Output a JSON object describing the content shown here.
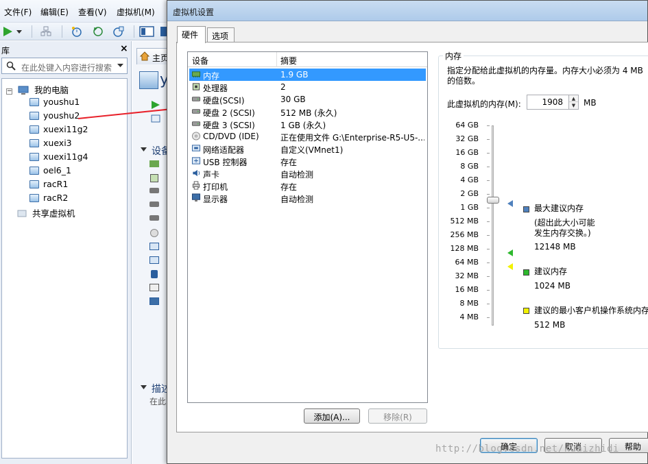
{
  "menu": {
    "file": "文件(F)",
    "edit": "编辑(E)",
    "view": "查看(V)",
    "vm": "虚拟机(M)"
  },
  "library": {
    "title": "库",
    "search_placeholder": "在此处键入内容进行搜索",
    "root": "我的电脑",
    "vms": [
      "youshu1",
      "youshu2",
      "xuexi11g2",
      "xuexi3",
      "xuexi11g4",
      "oel6_1",
      "racR1",
      "racR2"
    ],
    "shared": "共享虚拟机"
  },
  "middle": {
    "home_tab": "主页",
    "vm_title_fragment": "y",
    "devices_fragment": "设备",
    "desc_fragment": "描述",
    "desc_hint_fragment": "在此"
  },
  "dialog": {
    "title": "虚拟机设置",
    "tabs": [
      "硬件",
      "选项"
    ],
    "list_headers": {
      "device": "设备",
      "summary": "摘要"
    },
    "devices": [
      {
        "name": "内存",
        "summary": "1.9 GB",
        "icon": "memory-icon",
        "selected": true
      },
      {
        "name": "处理器",
        "summary": "2",
        "icon": "processor-icon"
      },
      {
        "name": "硬盘(SCSI)",
        "summary": "30 GB",
        "icon": "hard-disk-icon"
      },
      {
        "name": "硬盘 2 (SCSI)",
        "summary": "512 MB (永久)",
        "icon": "hard-disk-icon"
      },
      {
        "name": "硬盘 3 (SCSI)",
        "summary": "1 GB (永久)",
        "icon": "hard-disk-icon"
      },
      {
        "name": "CD/DVD (IDE)",
        "summary": "正在使用文件 G:\\Enterprise-R5-U5-...",
        "icon": "cd-dvd-icon"
      },
      {
        "name": "网络适配器",
        "summary": "自定义(VMnet1)",
        "icon": "network-adapter-icon"
      },
      {
        "name": "USB 控制器",
        "summary": "存在",
        "icon": "usb-icon"
      },
      {
        "name": "声卡",
        "summary": "自动检测",
        "icon": "sound-card-icon"
      },
      {
        "name": "打印机",
        "summary": "存在",
        "icon": "printer-icon"
      },
      {
        "name": "显示器",
        "summary": "自动检测",
        "icon": "display-icon"
      }
    ],
    "add_button": "添加(A)...",
    "remove_button": "移除(R)",
    "memory": {
      "group_title": "内存",
      "description": "指定分配给此虚拟机的内存量。内存大小必须为 4 MB 的倍数。",
      "label": "此虚拟机的内存(M):",
      "value": "1908",
      "unit": "MB",
      "scale": [
        "64 GB",
        "32 GB",
        "16 GB",
        "8 GB",
        "4 GB",
        "2 GB",
        "1 GB",
        "512 MB",
        "256 MB",
        "128 MB",
        "64 MB",
        "32 MB",
        "16 MB",
        "8 MB",
        "4 MB"
      ],
      "legend": {
        "max_title": "最大建议内存",
        "max_note": "(超出此大小可能发生内存交换。)",
        "max_value": "12148 MB",
        "rec_title": "建议内存",
        "rec_value": "1024 MB",
        "min_title": "建议的最小客户机操作系统内存",
        "min_value": "512 MB"
      },
      "colors": {
        "max": "#4f81bd",
        "rec": "#2eb82e",
        "min": "#f2f200"
      }
    },
    "ok_button": "确定",
    "cancel_button": "取消",
    "help_button": "帮助"
  },
  "watermark": "http://blog.csdn.net/kuaizhidi"
}
